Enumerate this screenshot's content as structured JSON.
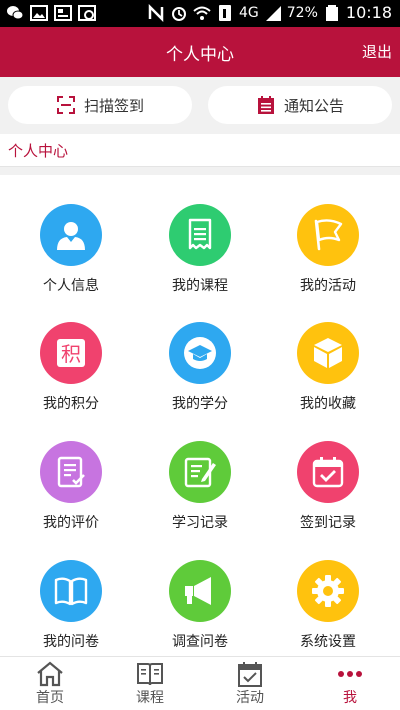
{
  "status_bar": {
    "network": "4G",
    "battery": "72%",
    "time": "10:18"
  },
  "header": {
    "title": "个人中心",
    "logout_label": "退出"
  },
  "quick_actions": {
    "scan_label": "扫描签到",
    "notice_label": "通知公告"
  },
  "breadcrumb": "个人中心",
  "menu": {
    "items": [
      {
        "label": "个人信息",
        "icon": "user-icon",
        "color": "#2ea8f0"
      },
      {
        "label": "我的课程",
        "icon": "receipt-icon",
        "color": "#2ecc71"
      },
      {
        "label": "我的活动",
        "icon": "flag-icon",
        "color": "#ffc20e"
      },
      {
        "label": "我的积分",
        "icon": "points-icon",
        "color": "#f0426e"
      },
      {
        "label": "我的学分",
        "icon": "graduation-cap-icon",
        "color": "#2ea8f0"
      },
      {
        "label": "我的收藏",
        "icon": "box-icon",
        "color": "#ffc20e"
      },
      {
        "label": "我的评价",
        "icon": "review-icon",
        "color": "#c774e0"
      },
      {
        "label": "学习记录",
        "icon": "edit-note-icon",
        "color": "#5fcb3a"
      },
      {
        "label": "签到记录",
        "icon": "calendar-check-icon",
        "color": "#f0426e"
      },
      {
        "label": "我的问卷",
        "icon": "book-icon",
        "color": "#2ea8f0"
      },
      {
        "label": "调查问卷",
        "icon": "megaphone-icon",
        "color": "#5fcb3a"
      },
      {
        "label": "系统设置",
        "icon": "gear-icon",
        "color": "#ffc20e"
      }
    ],
    "points_glyph": "积"
  },
  "bottom_nav": {
    "items": [
      {
        "label": "首页",
        "icon": "home-icon"
      },
      {
        "label": "课程",
        "icon": "open-book-icon"
      },
      {
        "label": "活动",
        "icon": "calendar-icon"
      },
      {
        "label": "我",
        "icon": "more-dots-icon"
      }
    ],
    "active_index": 3,
    "active_color": "#b8123c"
  }
}
